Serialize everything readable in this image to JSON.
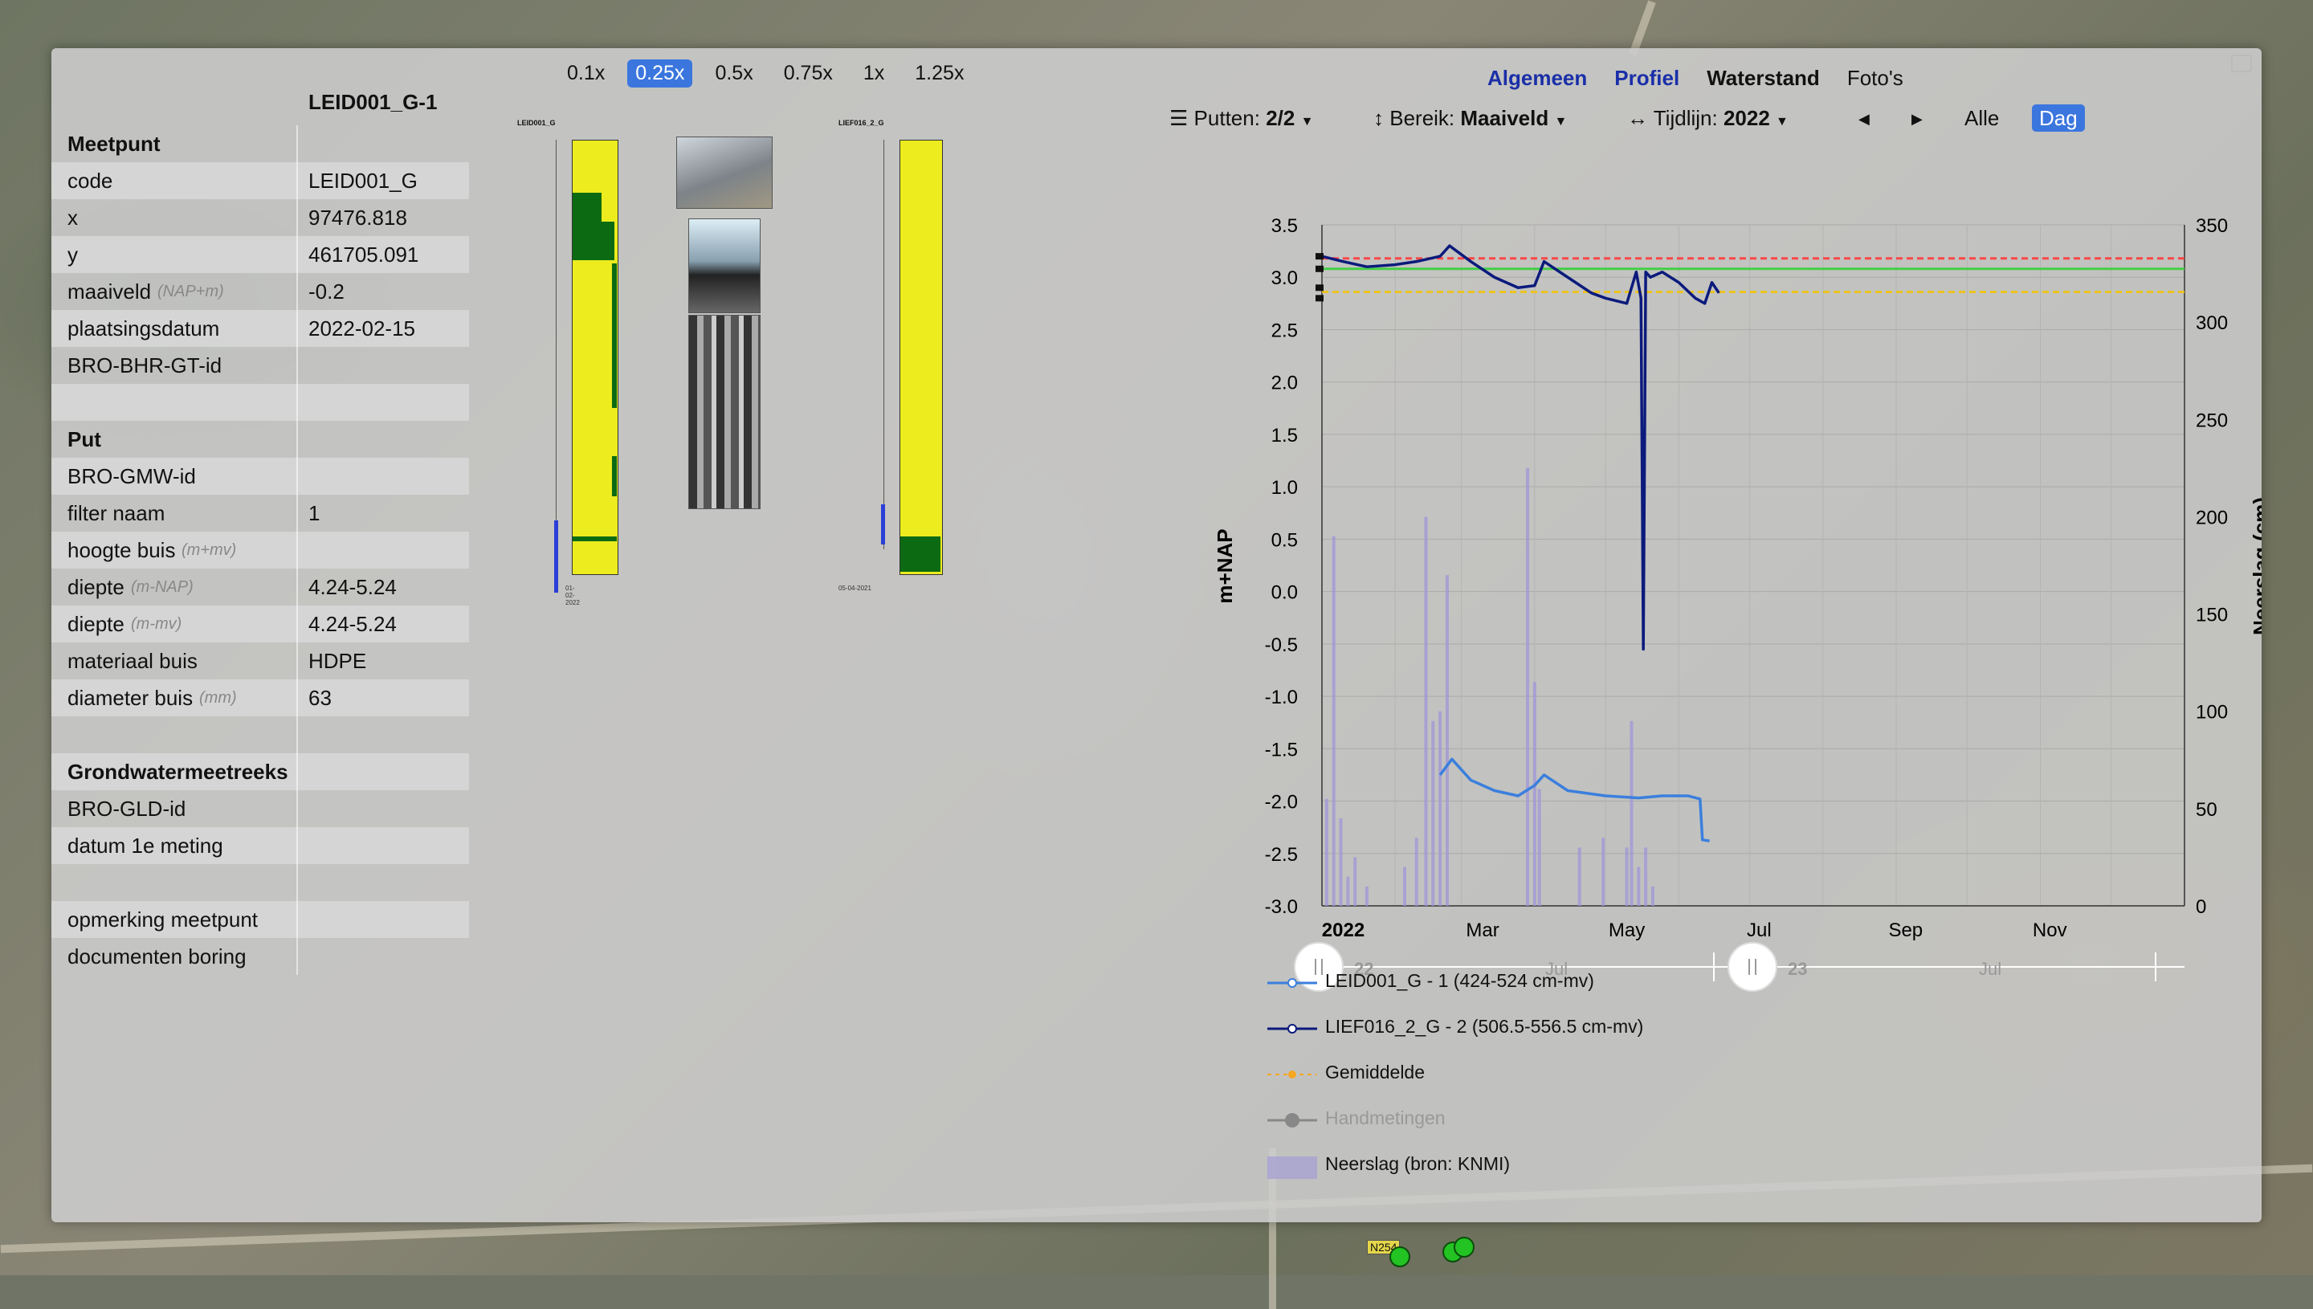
{
  "info_table": {
    "header": "LEID001_G-1",
    "rows": [
      {
        "type": "section",
        "key": "Meetpunt"
      },
      {
        "key": "code",
        "value": "LEID001_G"
      },
      {
        "key": "x",
        "value": "97476.818"
      },
      {
        "key": "y",
        "value": "461705.091"
      },
      {
        "key": "maaiveld",
        "unit": "(NAP+m)",
        "value": "-0.2"
      },
      {
        "key": "plaatsingsdatum",
        "value": "2022-02-15"
      },
      {
        "key": "BRO-BHR-GT-id",
        "value": ""
      },
      {
        "type": "blank"
      },
      {
        "type": "section",
        "key": "Put"
      },
      {
        "key": "BRO-GMW-id",
        "value": ""
      },
      {
        "key": "filter naam",
        "value": "1"
      },
      {
        "key": "hoogte buis",
        "unit": "(m+mv)",
        "value": ""
      },
      {
        "key": "diepte",
        "unit": "(m-NAP)",
        "value": "4.24-5.24"
      },
      {
        "key": "diepte",
        "unit": "(m-mv)",
        "value": "4.24-5.24"
      },
      {
        "key": "materiaal buis",
        "value": "HDPE"
      },
      {
        "key": "diameter buis",
        "unit": "(mm)",
        "value": "63"
      },
      {
        "type": "blank"
      },
      {
        "type": "section",
        "key": "Grondwatermeetreeks"
      },
      {
        "key": "BRO-GLD-id",
        "value": ""
      },
      {
        "key": "datum 1e meting",
        "value": ""
      },
      {
        "type": "blank"
      },
      {
        "key": "opmerking meetpunt",
        "value": ""
      },
      {
        "key": "documenten boring",
        "value": ""
      }
    ]
  },
  "zoom_options": [
    "0.1x",
    "0.25x",
    "0.5x",
    "0.75x",
    "1x",
    "1.25x"
  ],
  "zoom_selected": "0.25x",
  "borings": [
    {
      "title": "LEID001_G",
      "date": "01-02-2022"
    },
    {
      "title": "LIEF016_2_G",
      "date": "05-04-2021"
    }
  ],
  "tabs": [
    {
      "label": "Algemeen",
      "style": "blue"
    },
    {
      "label": "Profiel",
      "style": "blue"
    },
    {
      "label": "Waterstand",
      "style": "dark"
    },
    {
      "label": "Foto's",
      "style": "normal"
    }
  ],
  "controls": {
    "putten_label": "Putten:",
    "putten_value": "2/2",
    "bereik_label": "Bereik:",
    "bereik_value": "Maaiveld",
    "tijdlijn_label": "Tijdlijn:",
    "tijdlijn_value": "2022",
    "alle": "Alle",
    "dag": "Dag"
  },
  "icons": {
    "menu": "hamburger-icon",
    "bereik": "vertical-arrows-icon",
    "tijdlijn": "horizontal-arrows-icon",
    "prev": "triangle-left-icon",
    "next": "triangle-right-icon",
    "close": "minimize-icon"
  },
  "chart_data": {
    "type": "line",
    "ylabel": "m+NAP",
    "y2label": "Neerslag (cm)",
    "ylim": [
      -3.0,
      3.5
    ],
    "y2lim": [
      0,
      350
    ],
    "yticks": [
      "3.5",
      "3.0",
      "2.5",
      "2.0",
      "1.5",
      "1.0",
      "0.5",
      "0.0",
      "-0.5",
      "-1.0",
      "-1.5",
      "-2.0",
      "-2.5",
      "-3.0"
    ],
    "y2ticks": [
      "350",
      "300",
      "250",
      "200",
      "150",
      "100",
      "50",
      "0"
    ],
    "xticks": [
      "2022",
      "Mar",
      "May",
      "Jul",
      "Sep",
      "Nov"
    ],
    "grid": true,
    "thresholds": [
      {
        "color": "#ff3b3b",
        "value": 3.18
      },
      {
        "color": "#38d038",
        "value": 3.08
      },
      {
        "color": "#f1c40f",
        "value": 2.86
      }
    ],
    "series": [
      {
        "name": "LEID001_G - 1 (424-524 cm-mv)",
        "color": "#3b7fdd",
        "x": [
          "2022-02-20",
          "2022-02-25",
          "2022-03-05",
          "2022-03-15",
          "2022-03-25",
          "2022-04-01",
          "2022-04-05",
          "2022-04-15",
          "2022-05-01",
          "2022-05-15",
          "2022-05-25",
          "2022-06-05",
          "2022-06-10",
          "2022-06-11",
          "2022-06-14"
        ],
        "y": [
          -1.75,
          -1.6,
          -1.8,
          -1.9,
          -1.95,
          -1.85,
          -1.75,
          -1.9,
          -1.95,
          -1.97,
          -1.95,
          -1.95,
          -1.98,
          -2.37,
          -2.38
        ]
      },
      {
        "name": "LIEF016_2_G - 2 (506.5-556.5 cm-mv)",
        "color": "#0b1a7c",
        "x": [
          "2022-01-01",
          "2022-01-10",
          "2022-01-20",
          "2022-02-01",
          "2022-02-10",
          "2022-02-20",
          "2022-02-24",
          "2022-03-05",
          "2022-03-15",
          "2022-03-25",
          "2022-04-01",
          "2022-04-05",
          "2022-04-15",
          "2022-04-25",
          "2022-05-01",
          "2022-05-10",
          "2022-05-14",
          "2022-05-16",
          "2022-05-17",
          "2022-05-18",
          "2022-05-20",
          "2022-05-25",
          "2022-06-01",
          "2022-06-08",
          "2022-06-12",
          "2022-06-15",
          "2022-06-18"
        ],
        "y": [
          3.2,
          3.15,
          3.1,
          3.12,
          3.15,
          3.2,
          3.3,
          3.15,
          3.0,
          2.9,
          2.92,
          3.15,
          3.0,
          2.85,
          2.8,
          2.75,
          3.05,
          2.8,
          -0.55,
          3.05,
          3.0,
          3.05,
          2.95,
          2.8,
          2.75,
          2.95,
          2.85
        ]
      }
    ],
    "mean": {
      "name": "Gemiddelde",
      "color": "#f5a623"
    },
    "handmetingen": {
      "name": "Handmetingen",
      "color": "#888888"
    },
    "precip": {
      "name": "Neerslag (bron: KNMI)",
      "color": "#9f96d8",
      "x": [
        "2022-01-03",
        "2022-01-06",
        "2022-01-09",
        "2022-01-12",
        "2022-01-15",
        "2022-01-20",
        "2022-02-05",
        "2022-02-10",
        "2022-02-14",
        "2022-02-17",
        "2022-02-20",
        "2022-02-23",
        "2022-03-29",
        "2022-04-01",
        "2022-04-03",
        "2022-04-20",
        "2022-04-30",
        "2022-05-10",
        "2022-05-12",
        "2022-05-15",
        "2022-05-18",
        "2022-05-21"
      ],
      "y": [
        55,
        190,
        45,
        15,
        25,
        10,
        20,
        35,
        200,
        95,
        100,
        170,
        225,
        115,
        60,
        30,
        35,
        30,
        95,
        20,
        30,
        10
      ]
    }
  },
  "slider_labels": [
    "22",
    "Jul",
    "23",
    "Jul"
  ],
  "legend": [
    {
      "name": "LEID001_G - 1 (424-524 cm-mv)",
      "color": "#3b7fdd",
      "kind": "line"
    },
    {
      "name": "LIEF016_2_G - 2 (506.5-556.5 cm-mv)",
      "color": "#0b1a7c",
      "kind": "line"
    },
    {
      "name": "Gemiddelde",
      "color": "#f5a623",
      "kind": "dash"
    },
    {
      "name": "Handmetingen",
      "color": "#888888",
      "kind": "dot"
    },
    {
      "name": "Neerslag (bron: KNMI)",
      "color": "#9f96d8",
      "kind": "box"
    }
  ],
  "map_label": "N254"
}
